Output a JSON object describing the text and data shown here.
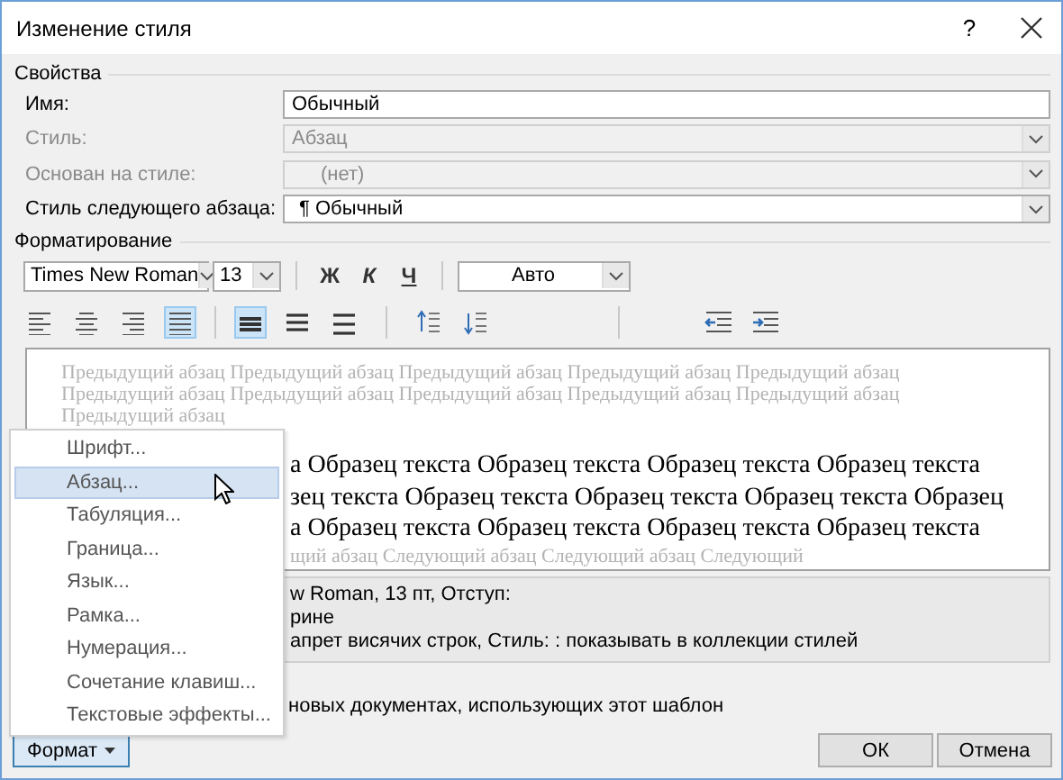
{
  "window": {
    "title": "Изменение стиля",
    "help": "?"
  },
  "properties": {
    "heading": "Свойства",
    "fields": [
      {
        "label": "Имя:",
        "value": "Обычный",
        "kind": "text",
        "disabled": false
      },
      {
        "label": "Стиль:",
        "value": "Абзац",
        "kind": "combo",
        "disabled": true
      },
      {
        "label": "Основан на стиле:",
        "value": "(нет)",
        "kind": "combo",
        "disabled": true
      },
      {
        "label": "Стиль следующего абзаца:",
        "value": "¶ Обычный",
        "kind": "combo",
        "disabled": false
      }
    ]
  },
  "formatting": {
    "heading": "Форматирование",
    "font": "Times New Roman",
    "size": "13",
    "bold": "Ж",
    "italic": "К",
    "underline": "Ч",
    "font_color": "Авто",
    "alignment": [
      {
        "selected": false
      },
      {
        "selected": false
      },
      {
        "selected": false
      },
      {
        "selected": true
      }
    ],
    "line_spacing": [
      {
        "selected": true
      },
      {
        "selected": false
      },
      {
        "selected": false
      }
    ]
  },
  "preview": {
    "previous_lines": [
      "Предыдущий абзац Предыдущий абзац Предыдущий абзац Предыдущий абзац Предыдущий абзац",
      "Предыдущий абзац Предыдущий абзац Предыдущий абзац Предыдущий абзац Предыдущий абзац",
      "Предыдущий абзац"
    ],
    "sample_lines": [
      "а Образец текста Образец текста Образец текста Образец текста",
      "зец текста Образец текста Образец текста Образец текста Образец",
      "а Образец текста Образец текста Образец текста Образец текста"
    ],
    "next_lines": [
      "щий абзац Следующий абзац Следующий абзац Следующий"
    ]
  },
  "description_lines": [
    "w Roman, 13 пт, Отступ:",
    "рине",
    "апрет висячих строк, Стиль: : показывать в коллекции стилей"
  ],
  "option_text": "новых документах, использующих этот шаблон",
  "format_button": {
    "label": "Формат",
    "expanded": true
  },
  "menu": [
    {
      "label": "Шрифт...",
      "selected": false
    },
    {
      "label": "Абзац...",
      "selected": true
    },
    {
      "label": "Табуляция...",
      "selected": false
    },
    {
      "label": "Граница...",
      "selected": false
    },
    {
      "label": "Язык...",
      "selected": false
    },
    {
      "label": "Рамка...",
      "selected": false
    },
    {
      "label": "Нумерация...",
      "selected": false
    },
    {
      "label": "Сочетание клавиш...",
      "selected": false
    },
    {
      "label": "Текстовые эффекты...",
      "selected": false
    }
  ],
  "buttons": [
    "ОК",
    "Отмена"
  ]
}
